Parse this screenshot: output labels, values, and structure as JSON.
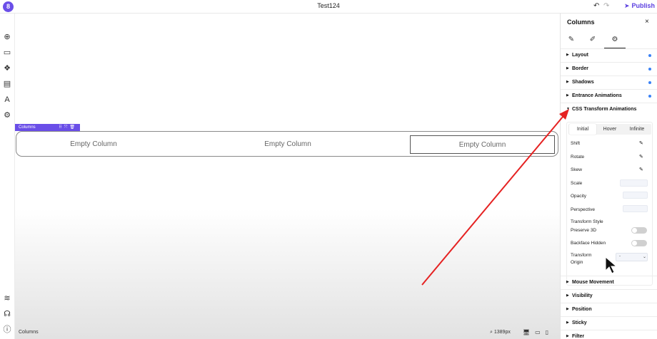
{
  "app": {
    "logo_text": "8",
    "doc_title": "Test124",
    "undo_icon": "undo-icon",
    "redo_icon": "redo-icon",
    "publish_label": "Publish",
    "accent_color": "#6a4ee8"
  },
  "left_toolbar": {
    "icons": [
      "add-icon",
      "section-icon",
      "components-icon",
      "pages-icon",
      "typography-icon",
      "settings-icon",
      "layers-icon",
      "support-icon",
      "info-icon"
    ]
  },
  "canvas": {
    "selection_tag": "Columns",
    "columns": [
      "Empty Column",
      "Empty Column",
      "Empty Column"
    ],
    "bottom_breadcrumb": "Columns",
    "zoom": "1389px"
  },
  "panel": {
    "title": "Columns",
    "close": "×",
    "tabs": [
      "pencil-icon",
      "brush-icon",
      "gear-icon"
    ],
    "sections_top": [
      {
        "label": "Layout",
        "dot": true
      },
      {
        "label": "Border",
        "dot": true
      },
      {
        "label": "Shadows",
        "dot": true
      },
      {
        "label": "Entrance Animations",
        "dot": true
      },
      {
        "label": "CSS Transform Animations",
        "dot": false
      }
    ],
    "transform": {
      "tabs": [
        "Initial",
        "Hover",
        "Infinite"
      ],
      "active_tab": "Initial",
      "shift": "Shift",
      "rotate": "Rotate",
      "skew": "Skew",
      "scale": "Scale",
      "opacity": "Opacity",
      "perspective": "Perspective",
      "transform_style": "Transform Style",
      "preserve_3d": "Preserve 3D",
      "backface_hidden": "Backface Hidden",
      "transform_origin_line1": "Transform",
      "transform_origin_line2": "Origin",
      "transform_origin_value": "-"
    },
    "sections_bottom": [
      "Mouse Movement",
      "Visibility",
      "Position",
      "Sticky",
      "Filter"
    ]
  }
}
